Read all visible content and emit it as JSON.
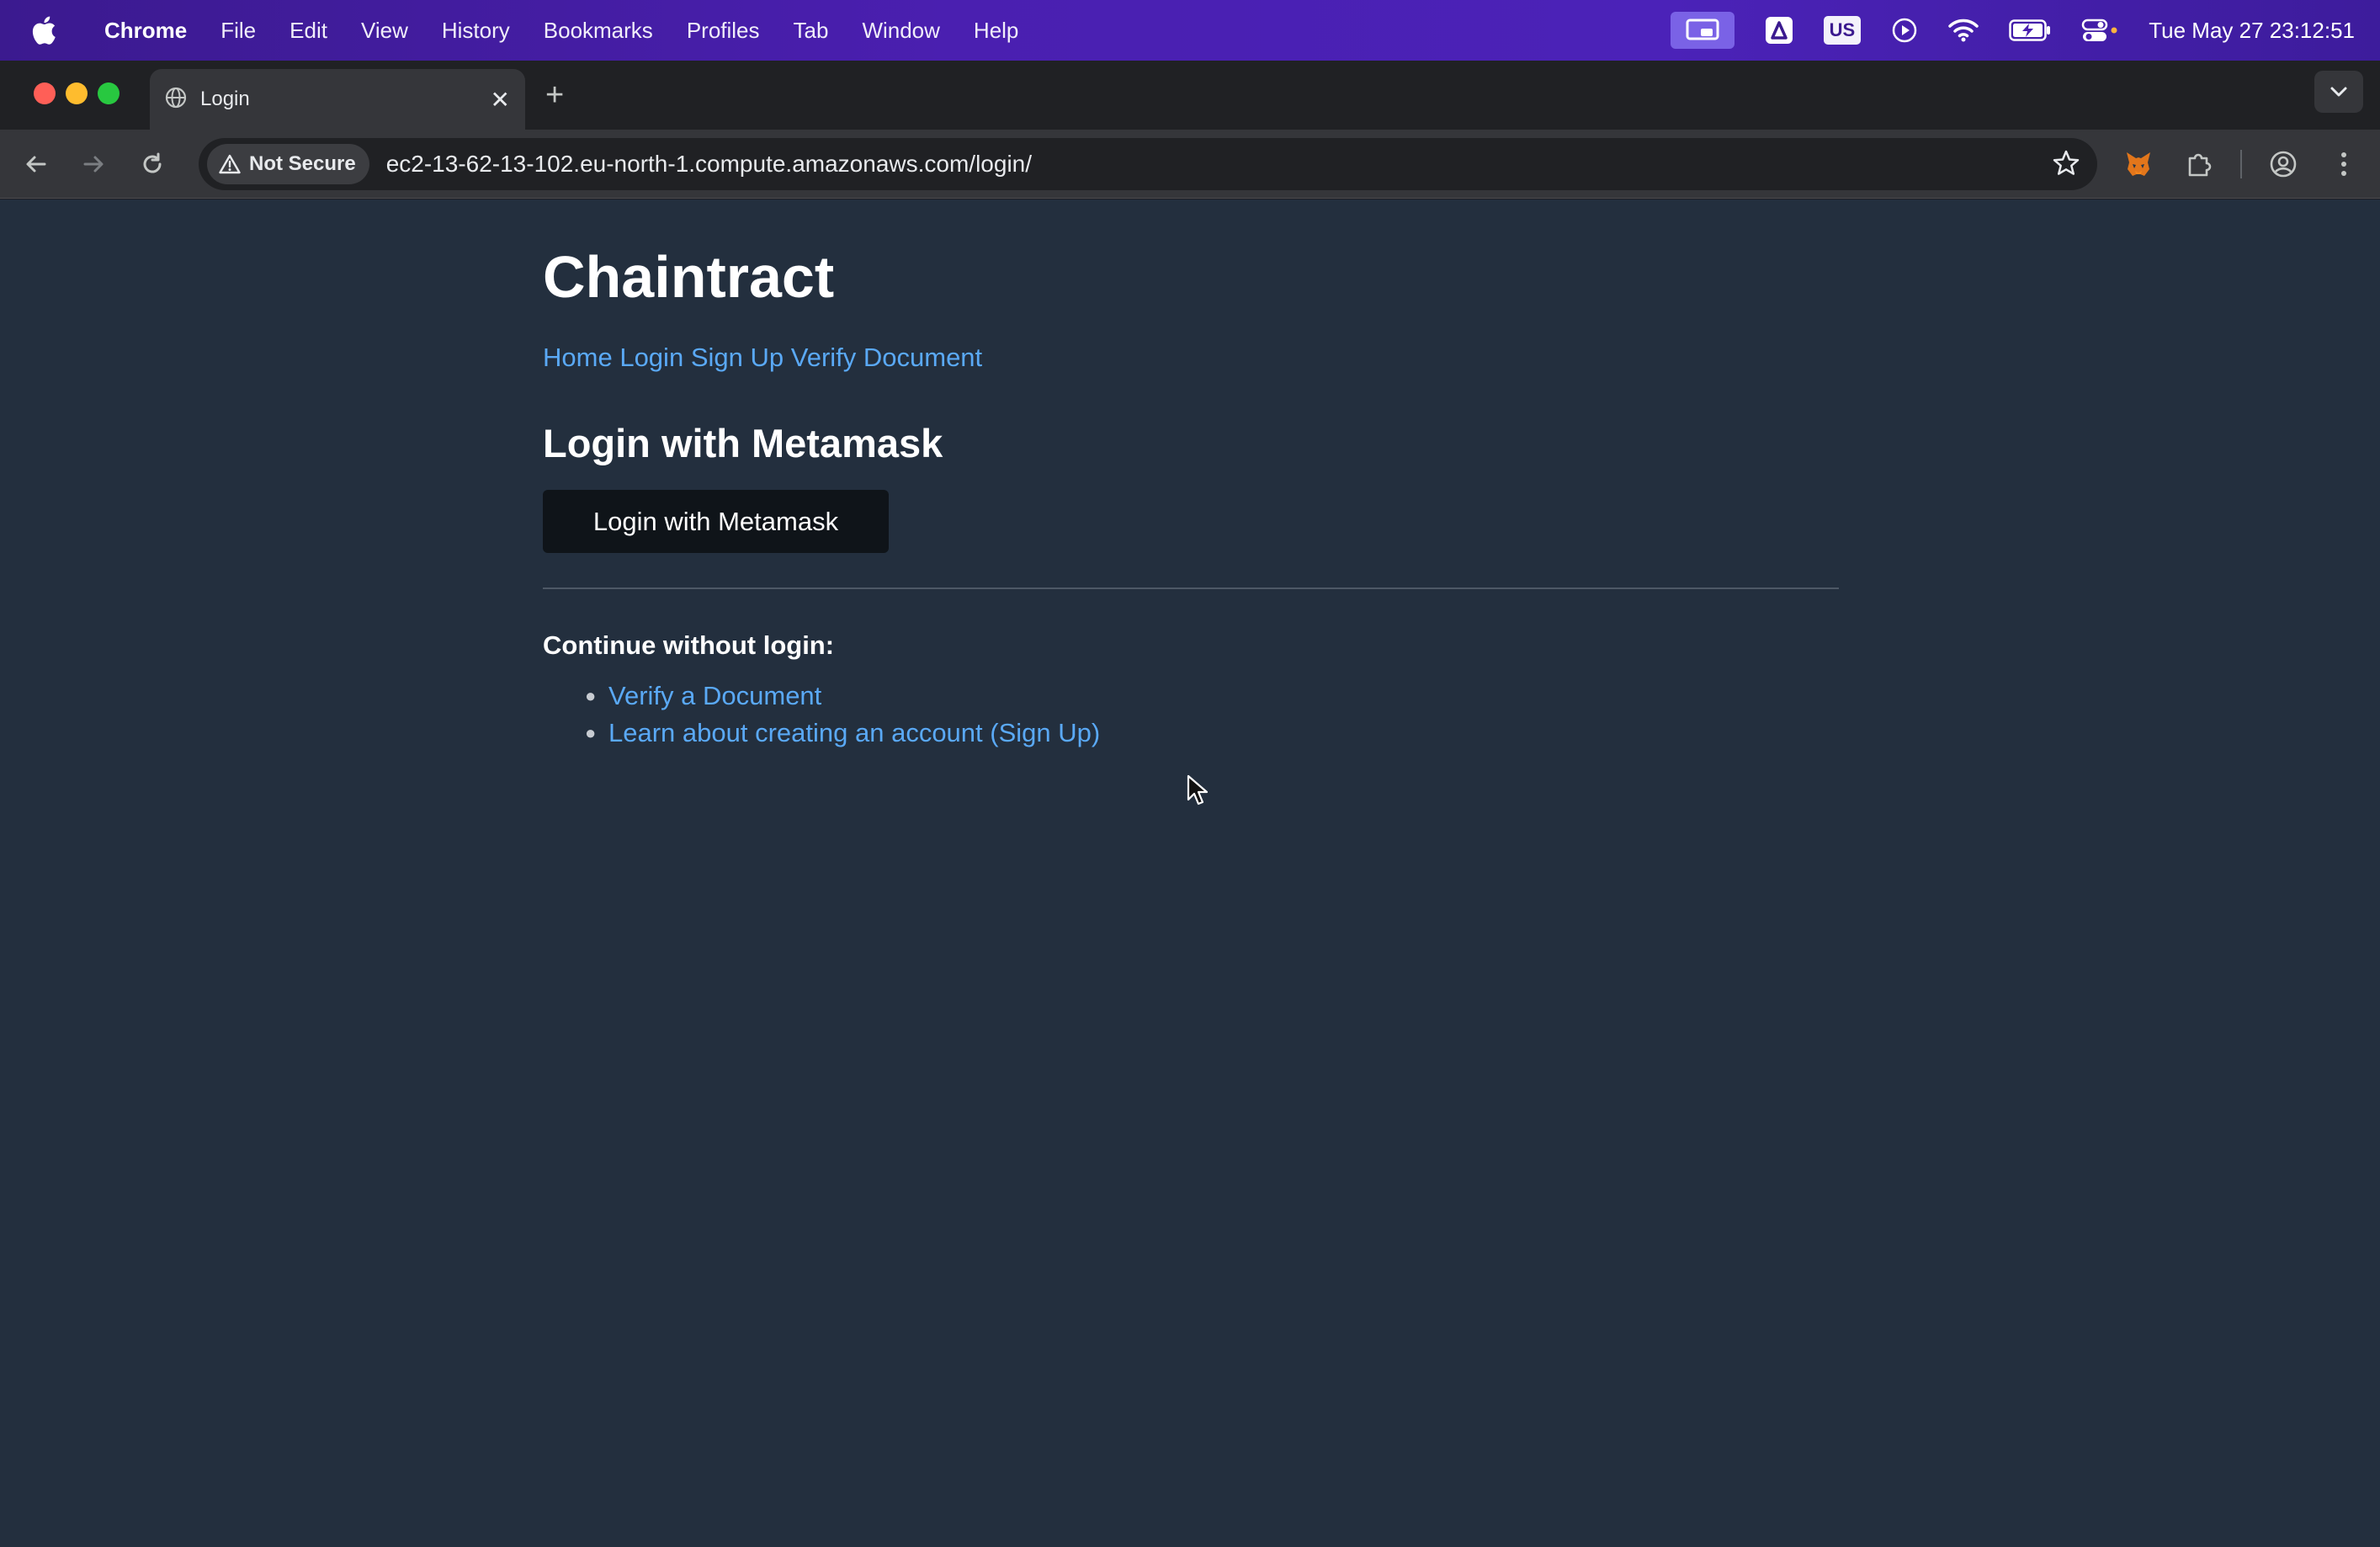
{
  "menubar": {
    "app_name": "Chrome",
    "items": [
      "File",
      "Edit",
      "View",
      "History",
      "Bookmarks",
      "Profiles",
      "Tab",
      "Window",
      "Help"
    ],
    "keyboard_layout": "US",
    "clock": "Tue May 27  23:12:51",
    "status_icons": [
      "screen-mirroring-icon",
      "app-a-icon",
      "keyboard-layout-icon",
      "play-icon",
      "wifi-icon",
      "battery-icon",
      "control-center-icon"
    ]
  },
  "browser": {
    "tab": {
      "title": "Login"
    },
    "security_label": "Not Secure",
    "url": "ec2-13-62-13-102.eu-north-1.compute.amazonaws.com/login/"
  },
  "page": {
    "site_title": "Chaintract",
    "nav": {
      "home": "Home",
      "login": "Login",
      "signup": "Sign Up",
      "verify": "Verify Document"
    },
    "section_title": "Login with Metamask",
    "metamask_button": "Login with Metamask",
    "continue_label": "Continue without login:",
    "links": {
      "verify": "Verify a Document",
      "learn": "Learn about creating an account (Sign Up)"
    }
  },
  "colors": {
    "menubar": "#4a1fb0",
    "page_background": "#232f3e",
    "link": "#5aa9f6",
    "button_background": "#0f1419"
  }
}
